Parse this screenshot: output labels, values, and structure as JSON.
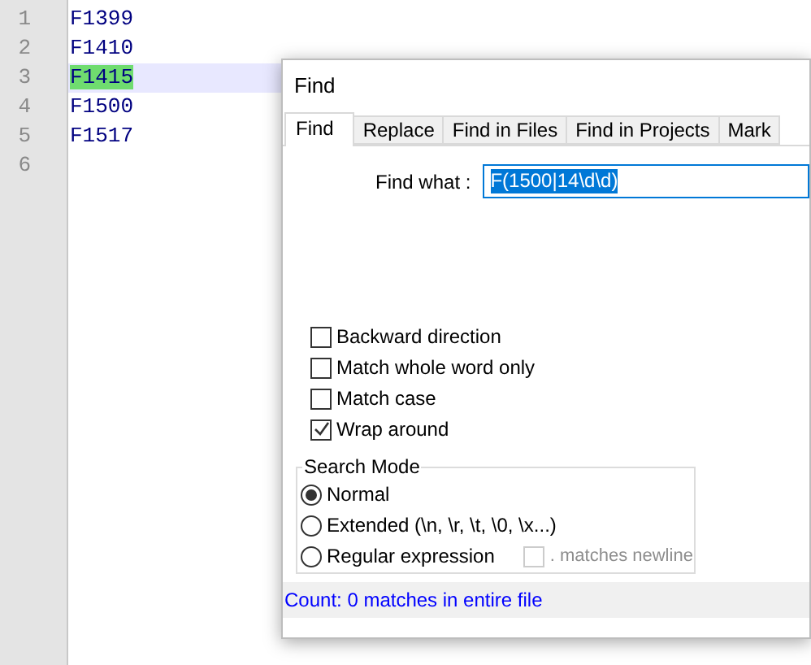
{
  "editor": {
    "lines": [
      {
        "number": "1",
        "text": "F1399",
        "current": false,
        "match": false
      },
      {
        "number": "2",
        "text": "F1410",
        "current": false,
        "match": false
      },
      {
        "number": "3",
        "text": "F1415",
        "current": true,
        "match": true
      },
      {
        "number": "4",
        "text": "F1500",
        "current": false,
        "match": false
      },
      {
        "number": "5",
        "text": "F1517",
        "current": false,
        "match": false
      },
      {
        "number": "6",
        "current": false
      }
    ]
  },
  "dialog": {
    "title": "Find",
    "tabs": [
      {
        "label": "Find",
        "selected": true
      },
      {
        "label": "Replace",
        "selected": false
      },
      {
        "label": "Find in Files",
        "selected": false
      },
      {
        "label": "Find in Projects",
        "selected": false
      },
      {
        "label": "Mark",
        "selected": false
      }
    ],
    "find_what": {
      "label": "Find what :",
      "value": "F(1500|14\\d\\d)"
    },
    "options": [
      {
        "label": "Backward direction",
        "checked": false
      },
      {
        "label": "Match whole word only",
        "checked": false
      },
      {
        "label": "Match case",
        "checked": false
      },
      {
        "label": "Wrap around",
        "checked": true
      }
    ],
    "search_mode": {
      "title": "Search Mode",
      "modes": [
        {
          "label": "Normal",
          "selected": true
        },
        {
          "label": "Extended (\\n, \\r, \\t, \\0, \\x...)",
          "selected": false
        },
        {
          "label": "Regular expression",
          "selected": false
        }
      ],
      "dot_matches_newline": {
        "label": ". matches newline",
        "checked": false,
        "disabled": true
      }
    },
    "status": "Count: 0 matches in entire file"
  }
}
